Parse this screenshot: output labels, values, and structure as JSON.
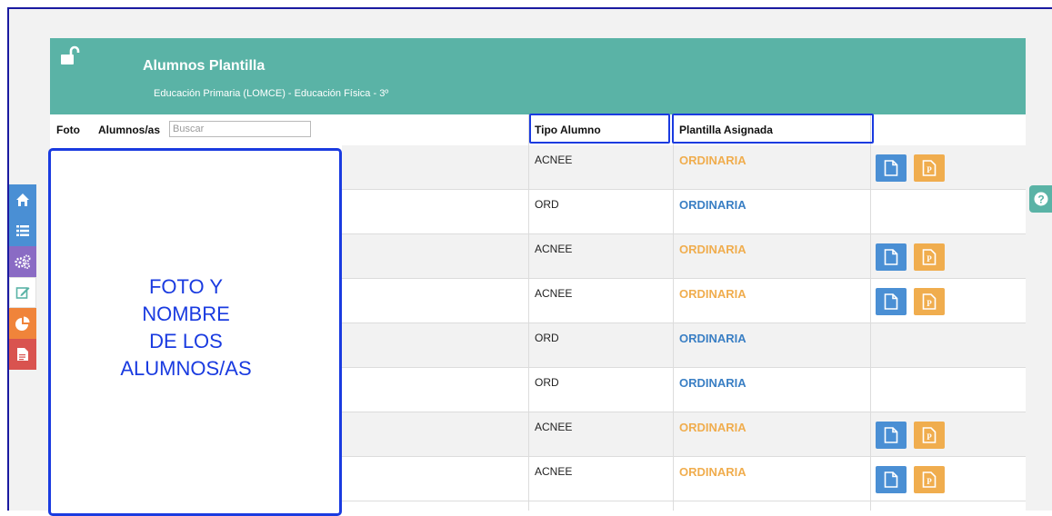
{
  "header": {
    "title": "Alumnos Plantilla",
    "subtitle": "Educación Primaria (LOMCE) - Educación Física - 3º"
  },
  "table": {
    "col_foto": "Foto",
    "col_alumnos": "Alumnos/as",
    "search_placeholder": "Buscar",
    "col_tipo": "Tipo Alumno",
    "col_plantilla": "Plantilla Asignada",
    "rows": [
      {
        "tipo": "ACNEE",
        "plantilla": "ORDINARIA",
        "plantilla_color": "#f0ad4e",
        "buttons": true
      },
      {
        "tipo": "ORD",
        "plantilla": "ORDINARIA",
        "plantilla_color": "#3a7fc4",
        "buttons": false
      },
      {
        "tipo": "ACNEE",
        "plantilla": "ORDINARIA",
        "plantilla_color": "#f0ad4e",
        "buttons": true
      },
      {
        "tipo": "ACNEE",
        "plantilla": "ORDINARIA",
        "plantilla_color": "#f0ad4e",
        "buttons": true
      },
      {
        "tipo": "ORD",
        "plantilla": "ORDINARIA",
        "plantilla_color": "#3a7fc4",
        "buttons": false
      },
      {
        "tipo": "ORD",
        "plantilla": "ORDINARIA",
        "plantilla_color": "#3a7fc4",
        "buttons": false
      },
      {
        "tipo": "ACNEE",
        "plantilla": "ORDINARIA",
        "plantilla_color": "#f0ad4e",
        "buttons": true
      },
      {
        "tipo": "ACNEE",
        "plantilla": "ORDINARIA",
        "plantilla_color": "#f0ad4e",
        "buttons": true
      }
    ]
  },
  "annotation": {
    "lines": [
      "FOTO Y",
      "NOMBRE",
      "DE LOS",
      "ALUMNOS/AS"
    ]
  },
  "sidebar": {
    "items": [
      {
        "icon": "home-icon",
        "color": "#4a8fd4"
      },
      {
        "icon": "list-icon",
        "color": "#4a8fd4"
      },
      {
        "icon": "gears-icon",
        "color": "#8a6bc4"
      },
      {
        "icon": "edit-icon",
        "color": "#ffffff"
      },
      {
        "icon": "pie-chart-icon",
        "color": "#f0843a"
      },
      {
        "icon": "file-icon",
        "color": "#d9534f"
      }
    ]
  },
  "colors": {
    "header": "#5ab3a6",
    "highlight": "#1a3be0",
    "doc_button": "#4a8fd4",
    "pdf_button": "#f0ad4e"
  }
}
